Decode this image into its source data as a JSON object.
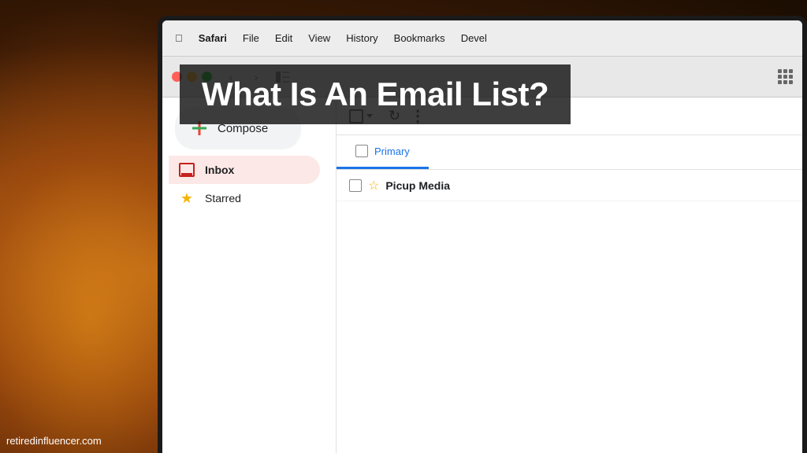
{
  "background": {
    "colors": {
      "dark_bg": "#2a1a08",
      "glow": "#c47820"
    }
  },
  "menubar": {
    "apple": "&#xf8ff;",
    "items": [
      {
        "label": "Safari"
      },
      {
        "label": "File"
      },
      {
        "label": "Edit"
      },
      {
        "label": "View"
      },
      {
        "label": "History"
      },
      {
        "label": "Bookmarks"
      },
      {
        "label": "Devel"
      }
    ]
  },
  "toolbar": {
    "back_label": "‹",
    "forward_label": "›",
    "sidebar_label": "⊡"
  },
  "overlay": {
    "title": "What Is An Email List?"
  },
  "gmail": {
    "compose_label": "Compose",
    "sidebar_items": [
      {
        "label": "Inbox",
        "active": true
      },
      {
        "label": "Starred",
        "active": false
      }
    ],
    "toolbar_icons": {
      "checkbox": "□",
      "dropdown": "▾",
      "refresh": "↻",
      "more": "⋮"
    },
    "category_tabs": [
      {
        "label": "Primary",
        "active": true
      }
    ],
    "email_sender": "Picup Media"
  },
  "attribution": {
    "url": "retiredinfluencer.com"
  }
}
